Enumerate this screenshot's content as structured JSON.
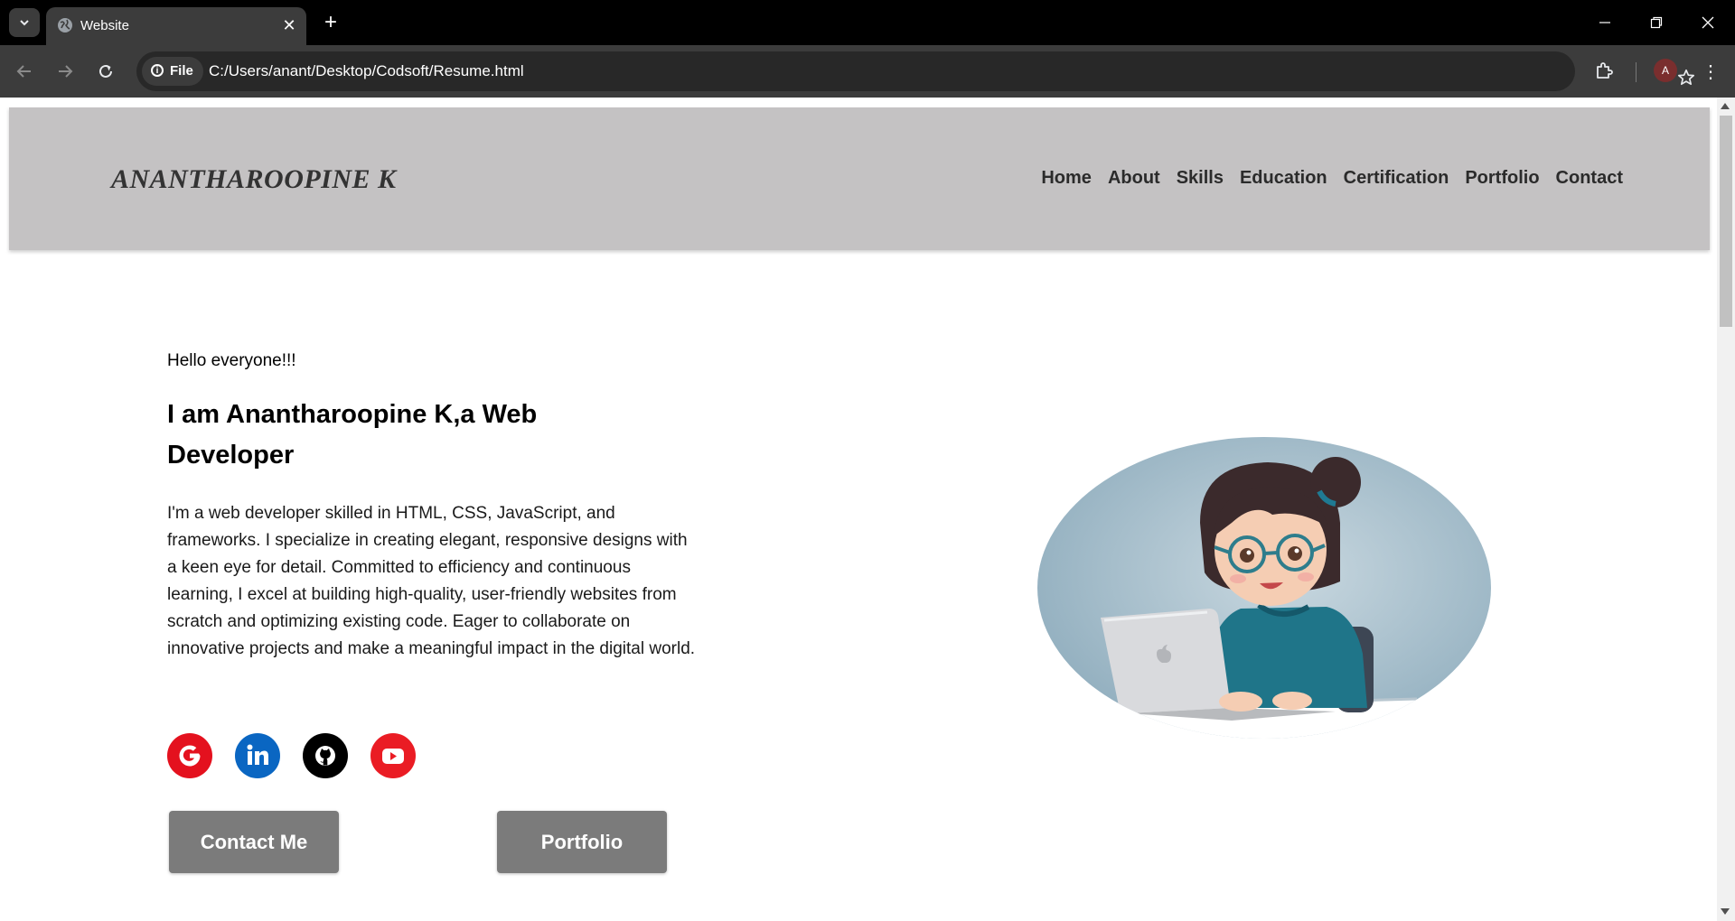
{
  "browser": {
    "tab_title": "Website",
    "address_chip": "File",
    "url": "C:/Users/anant/Desktop/Codsoft/Resume.html",
    "profile_initial": "A"
  },
  "site": {
    "logo": "ANANTHAROOPINE K",
    "nav": [
      "Home",
      "About",
      "Skills",
      "Education",
      "Certification",
      "Portfolio",
      "Contact"
    ]
  },
  "hero": {
    "greeting": "Hello everyone!!!",
    "headline": "I am Anantharoopine K,a Web Developer",
    "bio": "I'm a web developer skilled in HTML, CSS, JavaScript, and frameworks. I specialize in creating elegant, responsive designs with a keen eye for detail. Committed to efficiency and continuous learning, I excel at building high-quality, user-friendly websites from scratch and optimizing existing code. Eager to collaborate on innovative projects and make a meaningful impact in the digital world.",
    "buttons": {
      "contact": "Contact Me",
      "portfolio": "Portfolio"
    },
    "socials": [
      {
        "name": "google-icon",
        "color": "#e4111e"
      },
      {
        "name": "linkedin-icon",
        "color": "#0a66c2"
      },
      {
        "name": "github-icon",
        "color": "#000000"
      },
      {
        "name": "youtube-icon",
        "color": "#ea1c24"
      }
    ]
  },
  "colors": {
    "header_bg": "#c4c2c3",
    "button_bg": "#7b7b7b",
    "chrome_dark": "#000000",
    "chrome_toolbar": "#3c3c3c"
  }
}
